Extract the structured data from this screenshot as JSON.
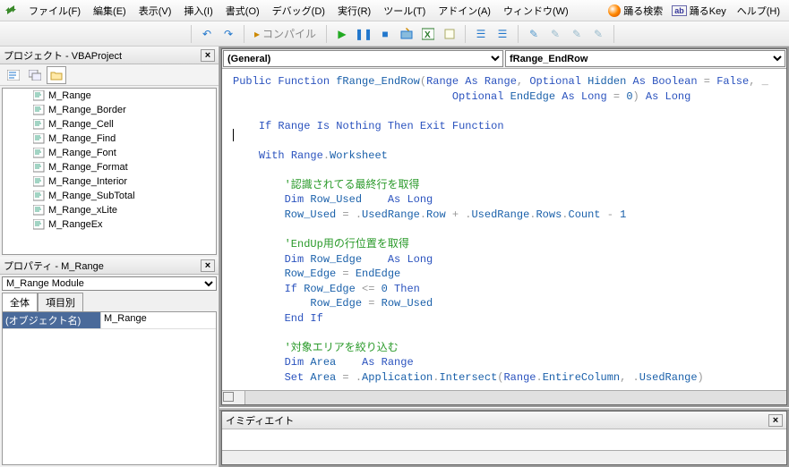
{
  "menus": {
    "file": "ファイル(F)",
    "edit": "編集(E)",
    "view": "表示(V)",
    "insert": "挿入(I)",
    "format": "書式(O)",
    "debug": "デバッグ(D)",
    "run": "実行(R)",
    "tools": "ツール(T)",
    "addins": "アドイン(A)",
    "window": "ウィンドウ(W)",
    "odoru_search": "踊る検索",
    "odoru_key": "踊るKey",
    "help": "ヘルプ(H)"
  },
  "toolbar": {
    "compile": "コンパイル"
  },
  "project_panel": {
    "title": "プロジェクト - VBAProject",
    "tree": [
      "M_Range",
      "M_Range_Border",
      "M_Range_Cell",
      "M_Range_Find",
      "M_Range_Font",
      "M_Range_Format",
      "M_Range_Interior",
      "M_Range_SubTotal",
      "M_Range_xLite",
      "M_RangeEx"
    ]
  },
  "props_panel": {
    "title": "プロパティ - M_Range",
    "module_select": "M_Range Module",
    "tabs": {
      "all": "全体",
      "categorized": "項目別"
    },
    "rows": {
      "objname_key": "(オブジェクト名)",
      "objname_val": "M_Range"
    }
  },
  "code": {
    "left_selector": "(General)",
    "right_selector": "fRange_EndRow",
    "body_plain": "Public Function fRange_EndRow(Range As Range, Optional Hidden As Boolean = False, _\n                                  Optional EndEdge As Long = 0) As Long\n\n    If Range Is Nothing Then Exit Function\n\n    With Range.Worksheet\n\n        '認識されてる最終行を取得\n        Dim Row_Used    As Long\n        Row_Used = .UsedRange.Row + .UsedRange.Rows.Count - 1\n\n        'EndUp用の行位置を取得\n        Dim Row_Edge    As Long\n        Row_Edge = EndEdge\n        If Row_Edge <= 0 Then\n            Row_Edge = Row_Used\n        End If\n\n        '対象エリアを絞り込む\n        Dim Area    As Range\n        Set Area = .Application.Intersect(Range.EntireColumn, .UsedRange)"
  },
  "immediate": {
    "title": "イミディエイト"
  },
  "chart_data": null
}
